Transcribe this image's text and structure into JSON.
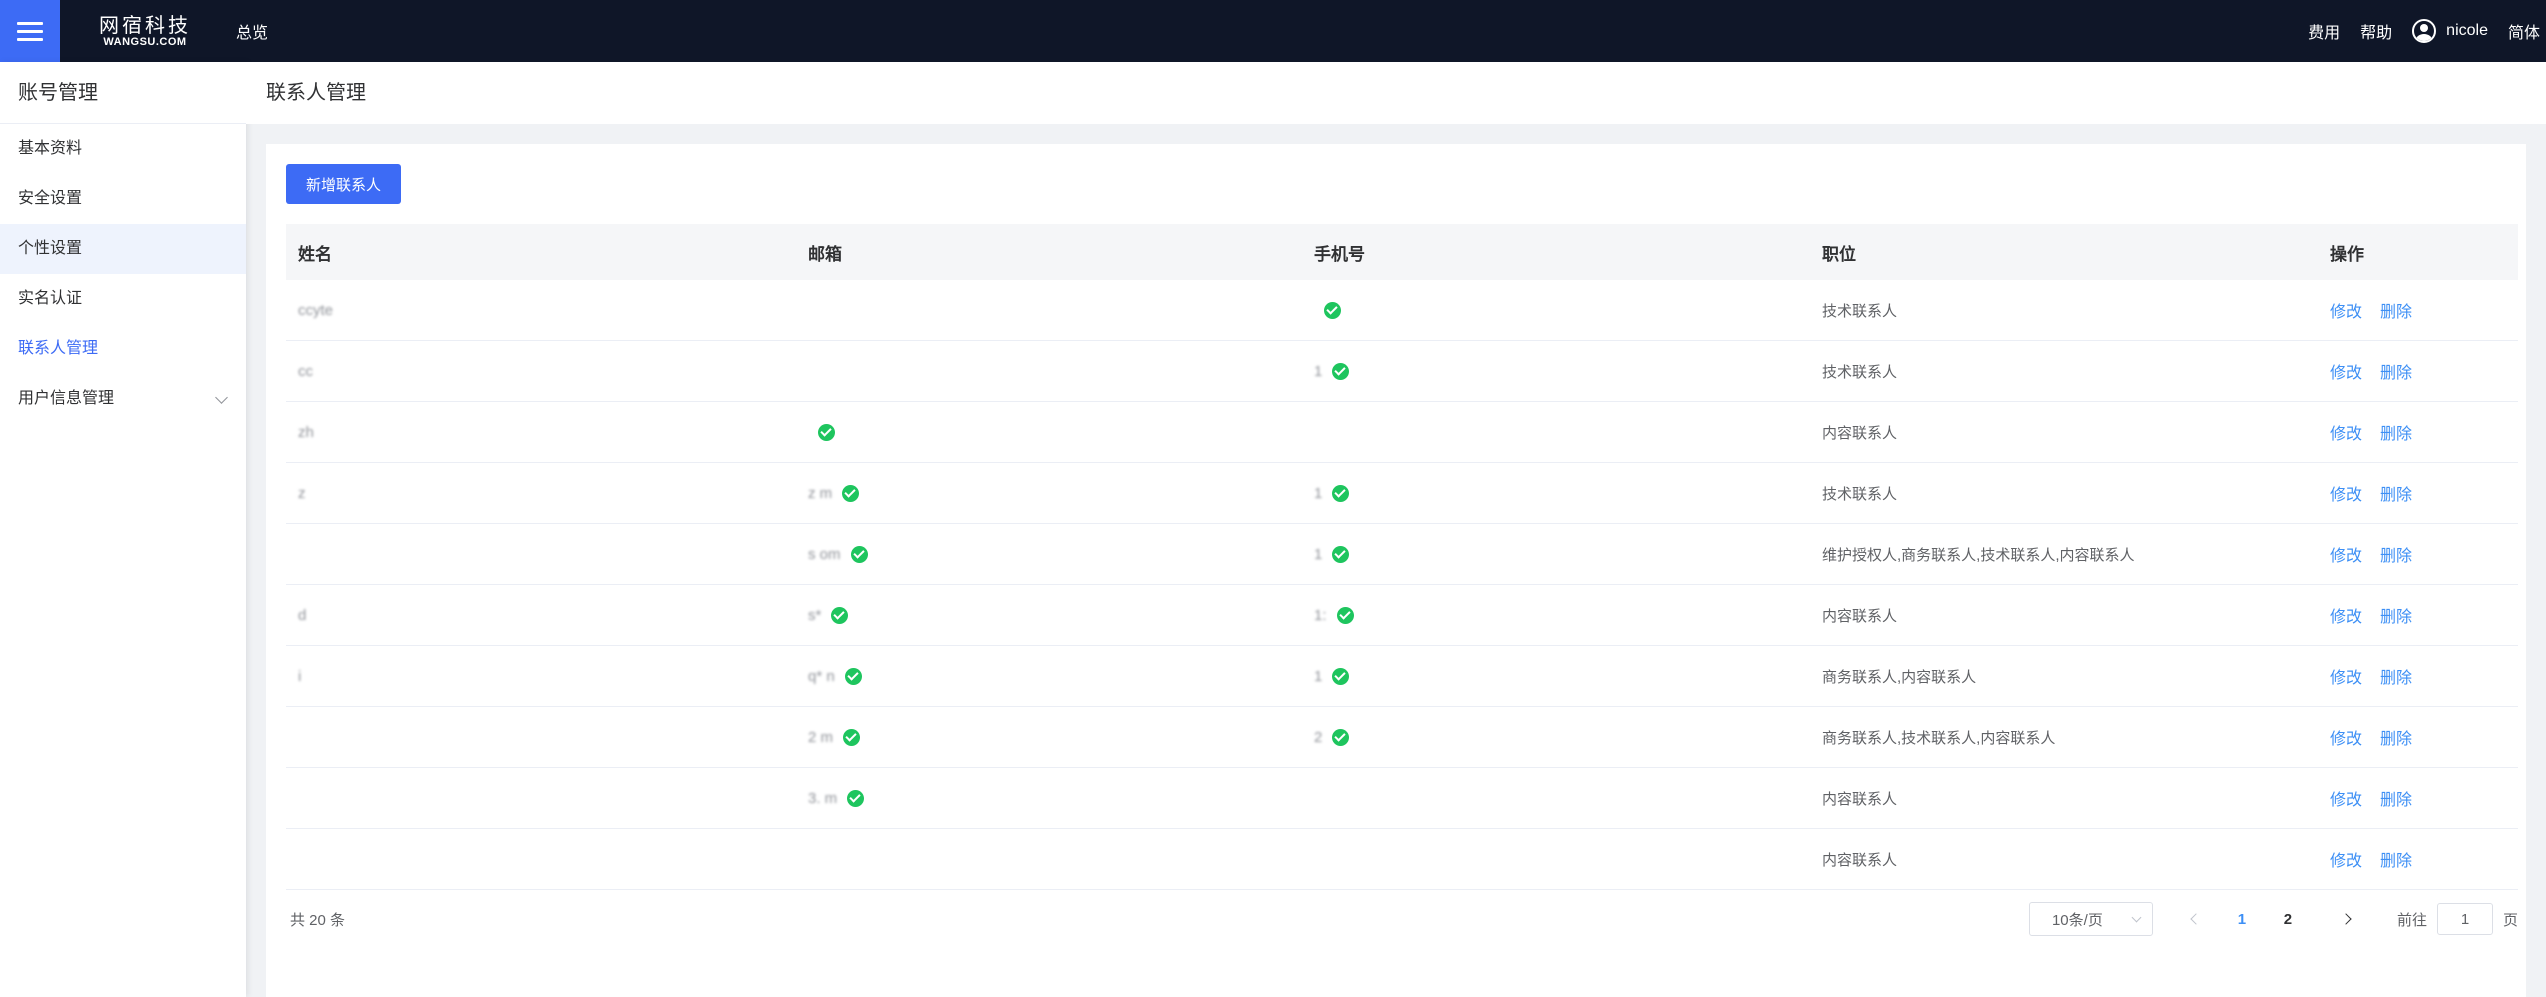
{
  "topbar": {
    "logo_cn": "网宿科技",
    "logo_en": "WANGSU.COM",
    "nav_overview": "总览",
    "fees": "费用",
    "help": "帮助",
    "username": "nicole",
    "language": "简体"
  },
  "sidebar": {
    "title": "账号管理",
    "items": [
      {
        "label": "基本资料"
      },
      {
        "label": "安全设置"
      },
      {
        "label": "个性设置"
      },
      {
        "label": "实名认证"
      },
      {
        "label": "联系人管理"
      },
      {
        "label": "用户信息管理"
      }
    ]
  },
  "page": {
    "title": "联系人管理",
    "add_button": "新增联系人"
  },
  "table": {
    "headers": [
      "姓名",
      "邮箱",
      "手机号",
      "职位",
      "操作"
    ],
    "edit_label": "修改",
    "delete_label": "删除",
    "rows": [
      {
        "name": "ccyte",
        "email": "",
        "email_verified": false,
        "phone": "",
        "phone_verified": true,
        "role": "技术联系人"
      },
      {
        "name": "cc",
        "email": "",
        "email_verified": false,
        "phone": "1",
        "phone_verified": true,
        "role": "技术联系人"
      },
      {
        "name": "zh",
        "email": "",
        "email_verified": true,
        "phone": "",
        "phone_verified": false,
        "role": "内容联系人"
      },
      {
        "name": "z",
        "email": "z m",
        "email_verified": true,
        "phone": "1",
        "phone_verified": true,
        "role": "技术联系人"
      },
      {
        "name": "",
        "email": "s om",
        "email_verified": true,
        "phone": "1",
        "phone_verified": true,
        "role": "维护授权人,商务联系人,技术联系人,内容联系人"
      },
      {
        "name": "d",
        "email": "s*",
        "email_verified": true,
        "phone": "1:",
        "phone_verified": true,
        "role": "内容联系人"
      },
      {
        "name": "i",
        "email": "q* n",
        "email_verified": true,
        "phone": "1",
        "phone_verified": true,
        "role": "商务联系人,内容联系人"
      },
      {
        "name": "",
        "email": "2 m",
        "email_verified": true,
        "phone": "2",
        "phone_verified": true,
        "role": "商务联系人,技术联系人,内容联系人"
      },
      {
        "name": "",
        "email": "3. m",
        "email_verified": true,
        "phone": "",
        "phone_verified": false,
        "role": "内容联系人"
      },
      {
        "name": "",
        "email": "",
        "email_verified": false,
        "phone": "",
        "phone_verified": false,
        "role": "内容联系人"
      }
    ]
  },
  "pagination": {
    "total": "共 20 条",
    "page_size": "10条/页",
    "pages": [
      "1",
      "2"
    ],
    "current_page": "1",
    "goto_prefix": "前往",
    "goto_value": "1",
    "goto_suffix": "页"
  },
  "colors": {
    "topbar_bg": "#0f1628",
    "accent": "#3d6bf5",
    "link": "#3d8ff5",
    "verified": "#1ec55e"
  },
  "icons": {
    "menu": "hamburger-icon",
    "user": "user-avatar-icon",
    "verified": "check-circle-icon",
    "dropdown": "chevron-down-icon",
    "prev": "chevron-left-icon",
    "next": "chevron-right-icon"
  }
}
